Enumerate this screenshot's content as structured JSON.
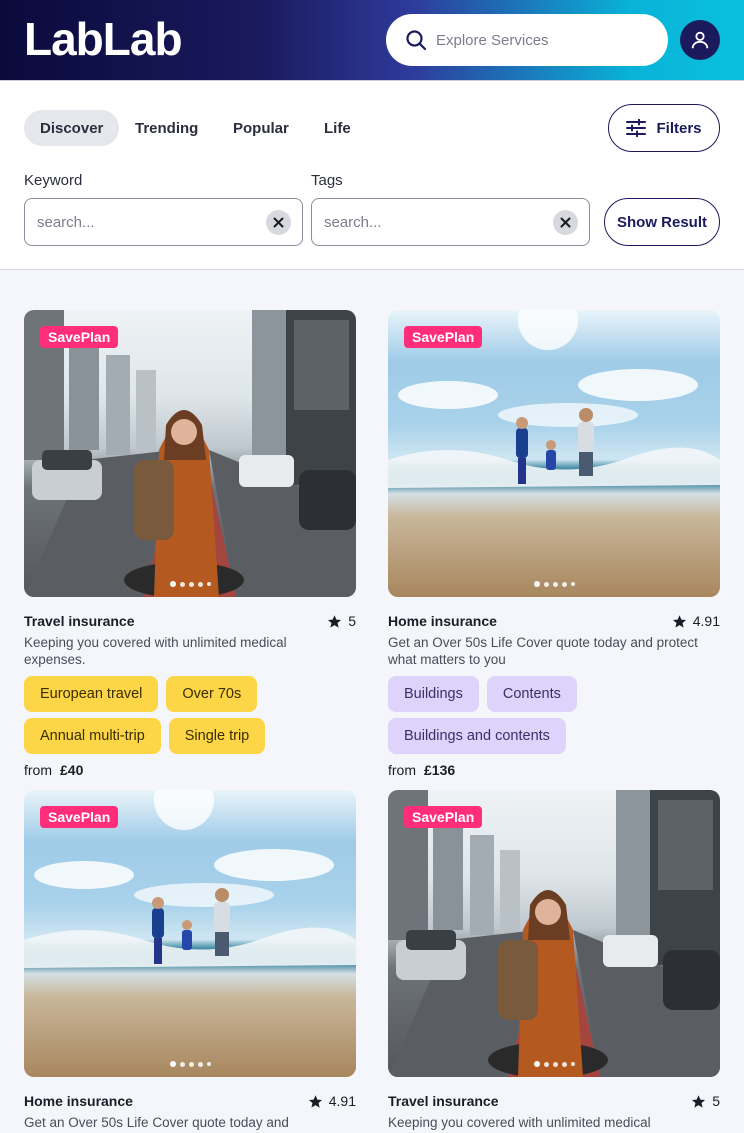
{
  "header": {
    "logo": "LabLab",
    "search_placeholder": "Explore Services"
  },
  "tabs": [
    {
      "label": "Discover",
      "active": true
    },
    {
      "label": "Trending"
    },
    {
      "label": "Popular"
    },
    {
      "label": "Life"
    }
  ],
  "filters_label": "Filters",
  "keyword": {
    "label": "Keyword",
    "placeholder": "search...",
    "value": ""
  },
  "tags_field": {
    "label": "Tags",
    "placeholder": "search...",
    "value": ""
  },
  "show_result_label": "Show Result",
  "cards": [
    {
      "badge": "SavePlan",
      "title": "Travel insurance",
      "rating": "5",
      "description": "Keeping you covered with unlimited medical expenses.",
      "tags": [
        "European travel",
        "Over 70s",
        "Annual multi-trip",
        "Single trip"
      ],
      "price_prefix": "from",
      "price": "£40"
    },
    {
      "badge": "SavePlan",
      "title": "Home insurance",
      "rating": "4.91",
      "description": "Get an Over 50s Life Cover quote today and protect what matters to you",
      "tags": [
        "Buildings",
        "Contents",
        "Buildings and contents"
      ],
      "price_prefix": "from",
      "price": "£136"
    },
    {
      "badge": "SavePlan",
      "title": "Home insurance",
      "rating": "4.91",
      "description": "Get an Over 50s Life Cover quote today and"
    },
    {
      "badge": "SavePlan",
      "title": "Travel insurance",
      "rating": "5",
      "description": "Keeping you covered with unlimited medical"
    }
  ],
  "colors": {
    "brand_navy": "#1b1a5c",
    "badge_pink": "#ff2d7a",
    "tag_yellow": "#fcd646",
    "tag_purple": "#ddd3fb"
  }
}
